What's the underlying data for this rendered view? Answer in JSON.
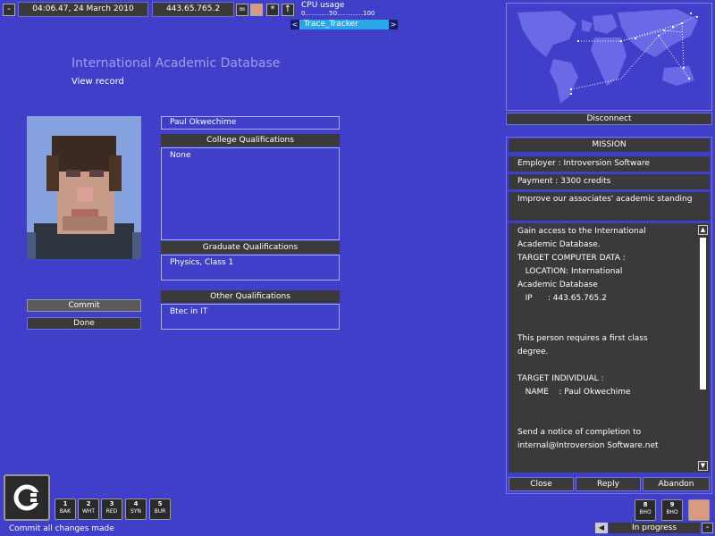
{
  "topbar": {
    "minimize_glyph": "-",
    "datetime": "04:06.47, 24 March 2010",
    "ip": "443.65.765.2",
    "cpu_label": "CPU usage",
    "cpu_scale": "0............50.............100",
    "trace_label": "Trace_Tracker",
    "arrow_left": "<",
    "arrow_right": ">",
    "btn_minus": "=",
    "btn_star": "*",
    "btn_up": "↑"
  },
  "page": {
    "title": "International Academic Database",
    "subtitle": "View record"
  },
  "record": {
    "name": "Paul Okwechime",
    "college_header": "College Qualifications",
    "college_value": "None",
    "graduate_header": "Graduate Qualifications",
    "graduate_value": "Physics, Class 1",
    "other_header": "Other Qualifications",
    "other_value": "Btec in IT",
    "commit_label": "Commit",
    "done_label": "Done"
  },
  "map": {
    "disconnect_label": "Disconnect"
  },
  "mission": {
    "title": "MISSION",
    "employer": "Employer : Introversion Software",
    "payment": "Payment : 3300 credits",
    "summary": "Improve our associates' academic standing",
    "body": [
      "Gain access to the International",
      "Academic Database.",
      "TARGET COMPUTER DATA :",
      "   LOCATION: International",
      "Academic Database",
      "   IP      : 443.65.765.2",
      "",
      "",
      "This person requires a first class",
      "degree.",
      "",
      "TARGET INDIVIDUAL :",
      "   NAME    : Paul Okwechime",
      "",
      "",
      "Send a notice of completion to",
      "internal@Introversion Software.net"
    ],
    "close_label": "Close",
    "reply_label": "Reply",
    "abandon_label": "Abandon"
  },
  "taskbar": {
    "status": "Commit all changes made",
    "keys": [
      {
        "num": "1",
        "label": "BAK"
      },
      {
        "num": "2",
        "label": "WHT"
      },
      {
        "num": "3",
        "label": "RED"
      },
      {
        "num": "4",
        "label": "SYN"
      },
      {
        "num": "5",
        "label": "BUR"
      }
    ],
    "right_keys": [
      {
        "num": "8",
        "label": "BHO"
      },
      {
        "num": "9",
        "label": "BHO"
      }
    ],
    "progress_label": "In progress",
    "minus": "-"
  },
  "colors": {
    "background": "#3f3fc9",
    "panel": "#3a3a3a",
    "accent_cyan": "#28a8e8"
  }
}
